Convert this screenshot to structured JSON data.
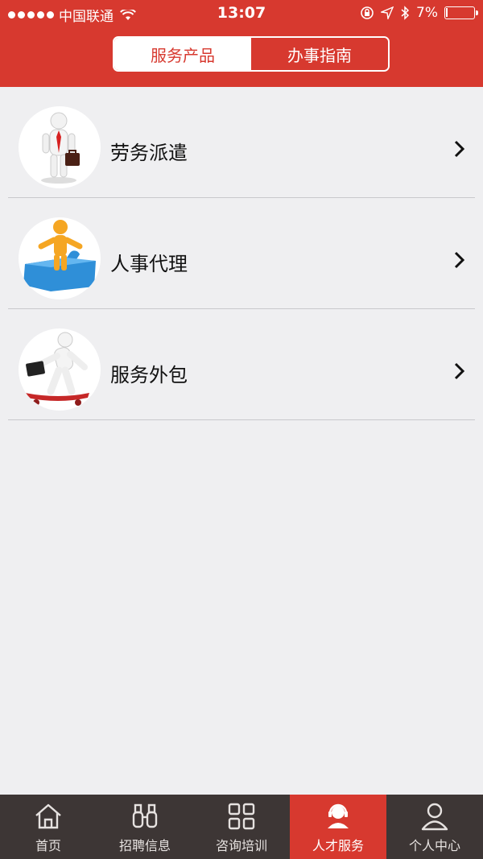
{
  "status_bar": {
    "carrier": "中国联通",
    "time": "13:07",
    "battery_percent": "7%",
    "battery_level": 0.07,
    "icons": [
      "signal-dots-icon",
      "wifi-icon",
      "rotation-lock-icon",
      "location-arrow-icon",
      "bluetooth-icon",
      "battery-icon"
    ]
  },
  "segmented": {
    "tabs": [
      {
        "label": "服务产品",
        "selected": true
      },
      {
        "label": "办事指南",
        "selected": false
      }
    ]
  },
  "list": {
    "items": [
      {
        "label": "劳务派遣",
        "icon": "businessman-with-briefcase-icon"
      },
      {
        "label": "人事代理",
        "icon": "figure-on-puzzle-piece-icon"
      },
      {
        "label": "服务外包",
        "icon": "figure-on-skateboard-icon"
      }
    ]
  },
  "tabbar": {
    "tabs": [
      {
        "label": "首页",
        "icon": "home-icon",
        "active": false
      },
      {
        "label": "招聘信息",
        "icon": "binoculars-icon",
        "active": false
      },
      {
        "label": "咨询培训",
        "icon": "grid-icon",
        "active": false
      },
      {
        "label": "人才服务",
        "icon": "headset-person-icon",
        "active": true
      },
      {
        "label": "个人中心",
        "icon": "user-icon",
        "active": false
      }
    ]
  },
  "colors": {
    "brand_red": "#d7392f",
    "tabbar_bg": "#3d3635",
    "page_bg": "#efeff1"
  }
}
